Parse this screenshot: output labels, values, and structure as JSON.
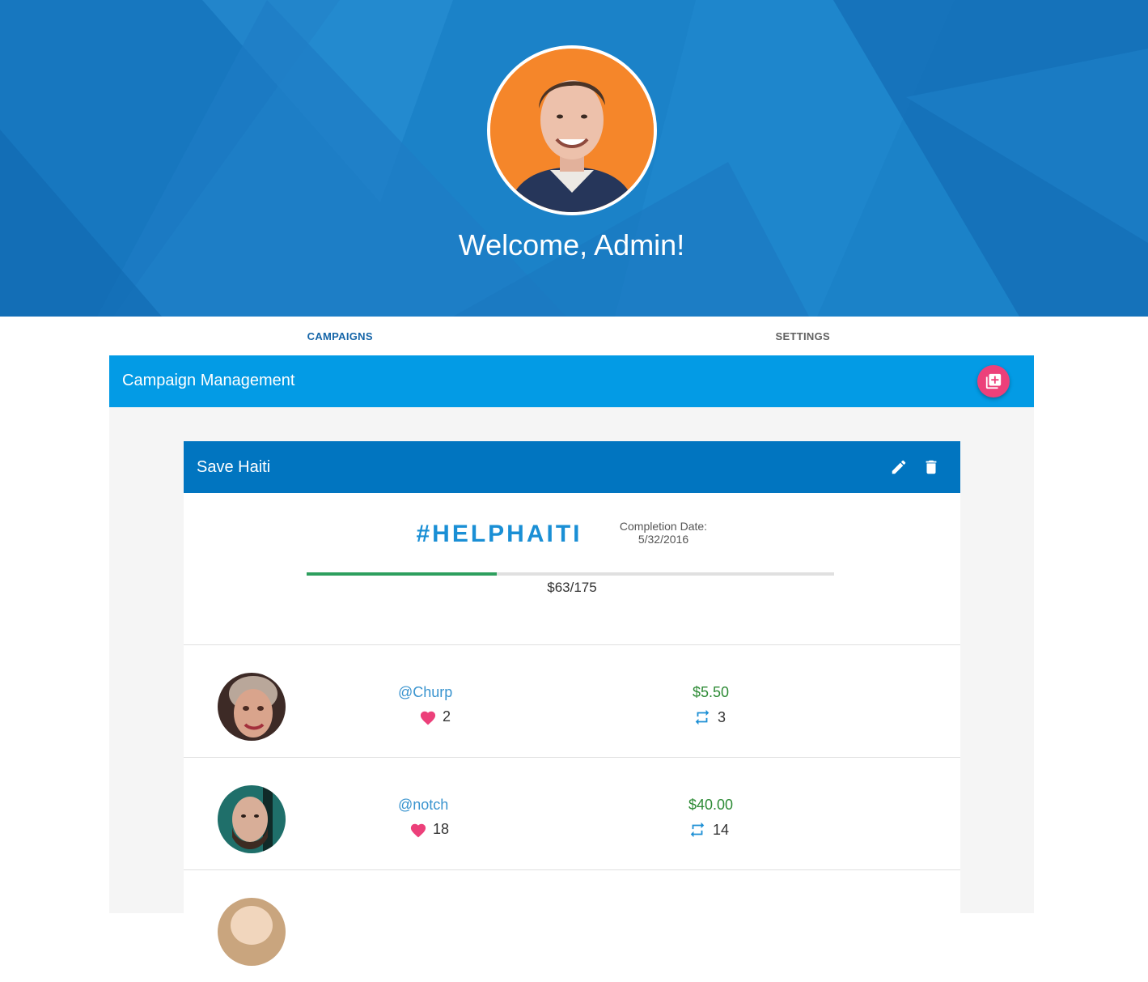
{
  "hero": {
    "welcome_text": "Welcome, Admin!",
    "avatar_background": "#f5862a"
  },
  "tabs": [
    {
      "label": "CAMPAIGNS",
      "active": true
    },
    {
      "label": "SETTINGS",
      "active": false
    }
  ],
  "panel": {
    "title": "Campaign Management",
    "fab_icon": "add-to-collection-icon",
    "header_color": "#039be5",
    "fab_color": "#ec407a"
  },
  "campaign": {
    "title": "Save Haiti",
    "hashtag": "#HELPHAITI",
    "completion_label": "Completion Date:",
    "completion_date": "5/32/2016",
    "raised_text": "$63/175",
    "progress_fraction": 0.36,
    "header_color": "#0175c0",
    "actions": {
      "edit_icon": "pencil-icon",
      "delete_icon": "trash-icon"
    }
  },
  "donors": [
    {
      "handle": "@Churp",
      "likes": "2",
      "amount": "$5.50",
      "retweets": "3"
    },
    {
      "handle": "@notch",
      "likes": "18",
      "amount": "$40.00",
      "retweets": "14"
    }
  ]
}
